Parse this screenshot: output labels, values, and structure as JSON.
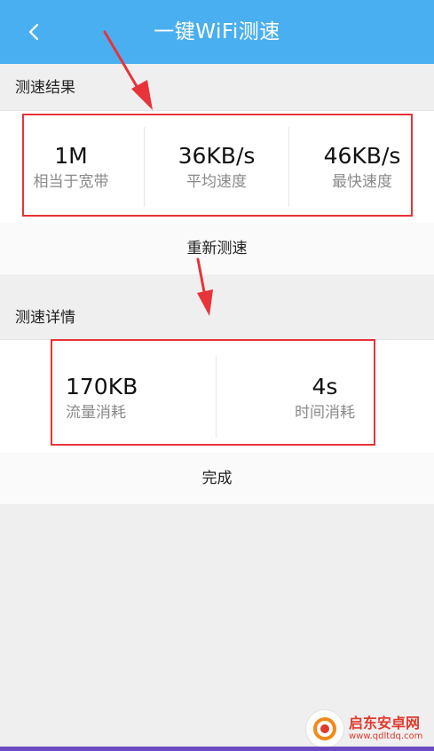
{
  "header": {
    "title": "一键WiFi测速",
    "back_icon": "chevron-left-icon"
  },
  "result_section": {
    "label": "测速结果",
    "stats": [
      {
        "value": "1M",
        "label": "相当于宽带"
      },
      {
        "value": "36KB/s",
        "label": "平均速度"
      },
      {
        "value": "46KB/s",
        "label": "最快速度"
      }
    ],
    "retest_label": "重新测速"
  },
  "detail_section": {
    "label": "测速详情",
    "stats": [
      {
        "value": "170KB",
        "label": "流量消耗"
      },
      {
        "value": "4s",
        "label": "时间消耗"
      }
    ],
    "done_label": "完成"
  },
  "watermark": {
    "name": "启东安卓网",
    "url": "www.qdltdq.com"
  },
  "colors": {
    "header_bg": "#4aaff0",
    "annotation_red": "#e8333a"
  }
}
